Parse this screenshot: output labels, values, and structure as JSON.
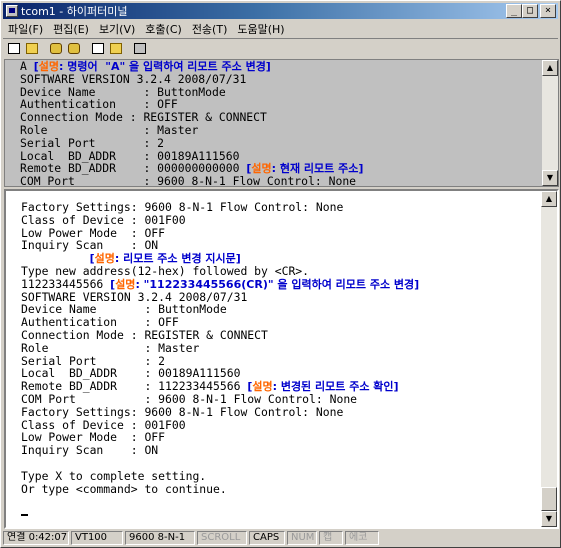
{
  "window": {
    "title": "tcom1 - 하이퍼터미널",
    "controls": [
      "_",
      "□",
      "×"
    ]
  },
  "menu": [
    "파일(F)",
    "편집(E)",
    "보기(V)",
    "호출(C)",
    "전송(T)",
    "도움말(H)"
  ],
  "toolbar": [
    "new-icon",
    "open-icon",
    "call-icon",
    "disconnect-icon",
    "send-icon",
    "receive-icon",
    "properties-icon"
  ],
  "upper_pane": {
    "lines": [
      {
        "text": "A ",
        "note": "[설명: 명령어  \"A\" 을 입력하여 리모트 주소 변경]"
      },
      {
        "text": "SOFTWARE VERSION 3.2.4 2008/07/31"
      },
      {
        "text": "Device Name       : ButtonMode"
      },
      {
        "text": "Authentication    : OFF"
      },
      {
        "text": "Connection Mode : REGISTER & CONNECT"
      },
      {
        "text": "Role              : Master"
      },
      {
        "text": "Serial Port       : 2"
      },
      {
        "text": "Local  BD_ADDR    : 00189A111560"
      },
      {
        "text": "Remote BD_ADDR    : 000000000000 ",
        "note": "[설명: 현재 리모트 주소]"
      },
      {
        "text": "COM Port          : 9600 8-N-1 Flow Control: None"
      }
    ]
  },
  "lower_pane": {
    "lines": [
      {
        "text": "Factory Settings: 9600 8-N-1 Flow Control: None"
      },
      {
        "text": "Class of Device : 001F00"
      },
      {
        "text": "Low Power Mode  : OFF"
      },
      {
        "text": "Inquiry Scan    : ON"
      },
      {
        "text": "          ",
        "note": "[설명: 리모트 주소 변경 지시문]"
      },
      {
        "text": "Type new address(12-hex) followed by <CR>."
      },
      {
        "text": "112233445566 ",
        "note": "[설명: \"112233445566(CR)\" 을 입력하여 리모트 주소 변경]"
      },
      {
        "text": "SOFTWARE VERSION 3.2.4 2008/07/31"
      },
      {
        "text": "Device Name       : ButtonMode"
      },
      {
        "text": "Authentication    : OFF"
      },
      {
        "text": "Connection Mode : REGISTER & CONNECT"
      },
      {
        "text": "Role              : Master"
      },
      {
        "text": "Serial Port       : 2"
      },
      {
        "text": "Local  BD_ADDR    : 00189A111560"
      },
      {
        "text": "Remote BD_ADDR    : 112233445566 ",
        "note": "[설명: 변경된 리모트 주소 확인]"
      },
      {
        "text": "COM Port          : 9600 8-N-1 Flow Control: None"
      },
      {
        "text": "Factory Settings: 9600 8-N-1 Flow Control: None"
      },
      {
        "text": "Class of Device : 001F00"
      },
      {
        "text": "Low Power Mode  : OFF"
      },
      {
        "text": "Inquiry Scan    : ON"
      },
      {
        "text": ""
      },
      {
        "text": "Type X to complete setting."
      },
      {
        "text": "Or type <command> to continue."
      },
      {
        "text": ""
      },
      {
        "text": "",
        "cursor": true
      }
    ]
  },
  "status": [
    {
      "label": "연결 0:42:07",
      "dim": false
    },
    {
      "label": "VT100",
      "dim": false
    },
    {
      "label": "9600 8-N-1",
      "dim": false
    },
    {
      "label": "SCROLL",
      "dim": true
    },
    {
      "label": "CAPS",
      "dim": false
    },
    {
      "label": "NUM",
      "dim": true
    },
    {
      "label": "캡",
      "dim": true
    },
    {
      "label": "에코",
      "dim": true
    }
  ]
}
